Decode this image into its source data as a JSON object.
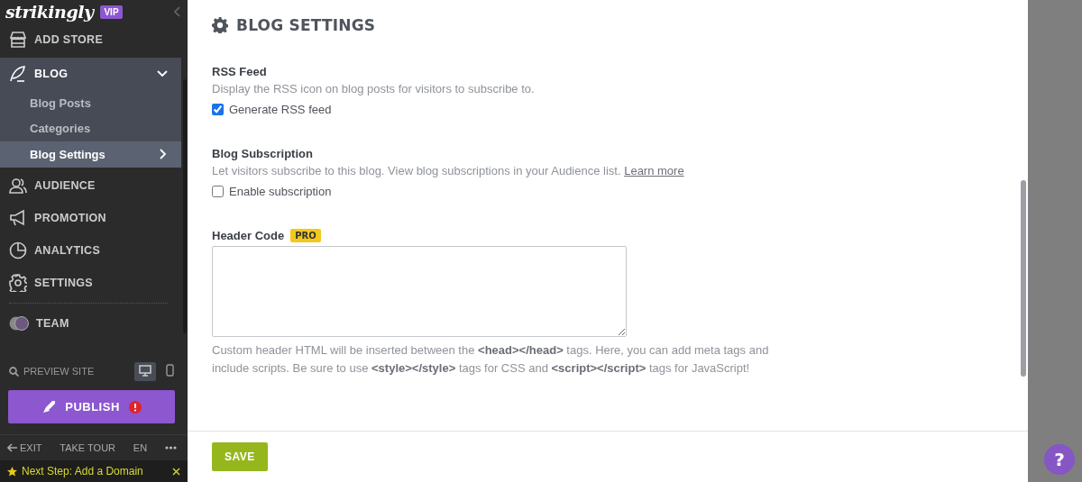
{
  "sidebar": {
    "logo": "strikingly",
    "badge": "VIP",
    "nav": [
      {
        "kind": "link",
        "label": "ADD STORE"
      },
      {
        "kind": "group",
        "label": "BLOG",
        "expanded": true,
        "children": [
          {
            "label": "Blog Posts",
            "selected": false
          },
          {
            "label": "Categories",
            "selected": false
          },
          {
            "label": "Blog Settings",
            "selected": true
          }
        ]
      },
      {
        "kind": "link",
        "label": "AUDIENCE"
      },
      {
        "kind": "link",
        "label": "PROMOTION"
      },
      {
        "kind": "link",
        "label": "ANALYTICS"
      },
      {
        "kind": "link",
        "label": "SETTINGS"
      },
      {
        "kind": "team",
        "label": "TEAM"
      }
    ],
    "preview": {
      "label": "PREVIEW SITE",
      "view_modes": [
        {
          "kind": "desktop",
          "selected": true
        },
        {
          "kind": "mobile",
          "selected": false
        }
      ]
    },
    "publish": "PUBLISH",
    "footer_links": [
      "EXIT",
      "TAKE TOUR",
      "EN"
    ],
    "next_step": "Next Step: Add a Domain"
  },
  "panel": {
    "title": "BLOG SETTINGS",
    "sections": [
      {
        "kind": "checkbox",
        "heading": "RSS Feed",
        "description": "Display the RSS icon on blog posts for visitors to subscribe to.",
        "option": "Generate RSS feed",
        "checked": true
      },
      {
        "kind": "checkbox",
        "heading": "Blog Subscription",
        "description": "Let visitors subscribe to this blog. View blog subscriptions in your Audience list.",
        "link": "Learn more",
        "option": "Enable subscription",
        "checked": false
      },
      {
        "kind": "code",
        "heading": "Header Code",
        "badge": "PRO",
        "help": "Custom header HTML will be inserted between the **<head></head>** tags. Here, you can add meta tags and include scripts. Be sure to use **<style></style>** tags for CSS and **<script></script>** tags for JavaScript!"
      }
    ],
    "save": "SAVE"
  },
  "help_button": "?"
}
